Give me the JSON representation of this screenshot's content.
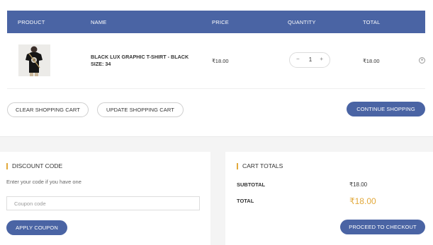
{
  "table": {
    "headers": {
      "product": "PRODUCT",
      "name": "NAME",
      "price": "PRICE",
      "quantity": "QUANTITY",
      "total": "TOTAL"
    },
    "items": [
      {
        "name": "BLACK LUX GRAPHIC T-SHIRT - BLACK",
        "size": "SIZE: 34",
        "price": "₹18.00",
        "quantity": "1",
        "total": "₹18.00"
      }
    ]
  },
  "qty_controls": {
    "minus": "−",
    "plus": "+"
  },
  "remove_symbol": "×",
  "actions": {
    "clear": "CLEAR SHOPPING CART",
    "update": "UPDATE SHOPPING CART",
    "continue": "CONTINUE SHOPPING"
  },
  "discount": {
    "title": "DISCOUNT CODE",
    "hint": "Enter your code if you have one",
    "placeholder": "Coupon code",
    "apply": "APPLY COUPON"
  },
  "cart_totals": {
    "title": "CART TOTALS",
    "subtotal_label": "SUBTOTAL",
    "subtotal_value": "₹18.00",
    "total_label": "TOTAL",
    "total_value": "₹18.00",
    "checkout": "PROCEED TO CHECKOUT"
  },
  "colors": {
    "primary": "#4a64a4",
    "accent": "#e2a93b",
    "page_background": "#f4f4f4"
  }
}
